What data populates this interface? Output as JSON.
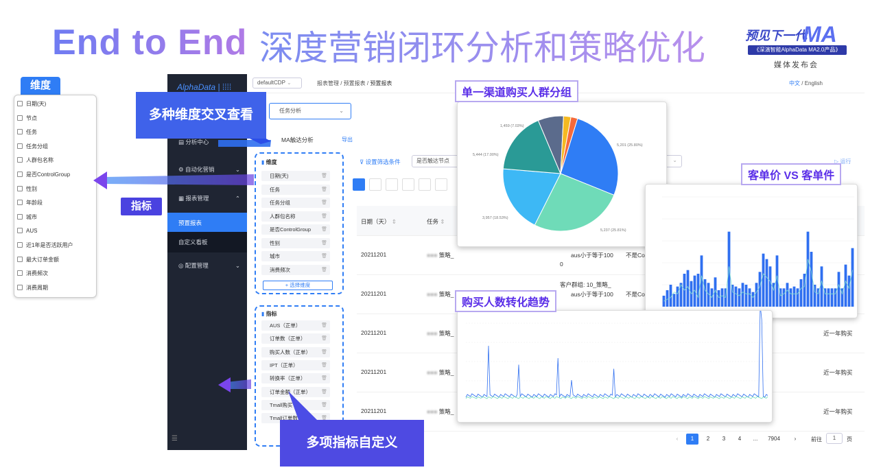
{
  "title": {
    "en": "End to End",
    "cn": "深度营销闭环分析和策略优化"
  },
  "logo": {
    "top": "预见下一代",
    "ma": "MA",
    "bar": "《深演智能AlphaData MA2.0产品》",
    "sub": "媒体发布会"
  },
  "dim_panel": {
    "tag": "维度",
    "items": [
      "日期(天)",
      "节点",
      "任务",
      "任务分组",
      "人群包名称",
      "是否ControlGroup",
      "性别",
      "年龄段",
      "城市",
      "AUS",
      "近1年是否活跃用户",
      "最大订单金额",
      "消费频次",
      "消费周期"
    ]
  },
  "callouts": {
    "multi_dim": "多种维度交叉查看",
    "metrics": "指标",
    "multi_metric": "多项指标自定义"
  },
  "sidebar": {
    "logo": "AlphaData | ⁞⁞⁞⁞",
    "items": [
      "分析中心",
      "自动化营销",
      "报表管理",
      "预置报表",
      "自定义看板",
      "配置管理"
    ],
    "footer_icon": "menu-icon"
  },
  "topbar": {
    "cdp": "defaultCDP",
    "breadcrumb": [
      "报表管理",
      "预置报表",
      "预置报表"
    ],
    "lang_cn": "中文",
    "lang_en": "English",
    "lang_sep": "/"
  },
  "main": {
    "task_select": "任务分析",
    "report_name": "MA触达分析",
    "export": "导出",
    "filter_label": "设置筛选条件",
    "filter_node": "是否触达节点",
    "run": "运行"
  },
  "dim_box": {
    "label": "维度",
    "items": [
      "日期(天)",
      "任务",
      "任务分组",
      "人群包名称",
      "是否ControlGroup",
      "性别",
      "城市",
      "消费频次"
    ],
    "add": "+ 选择维度"
  },
  "metric_box": {
    "label": "指标",
    "items": [
      "AUS（正单）",
      "订单数（正单）",
      "购买人数（正单）",
      "IPT（正单）",
      "转换率（正单）",
      "订单金额（正单）",
      "Tmall购买",
      "Tmall订单数"
    ]
  },
  "table": {
    "headers": [
      "日期（天）",
      "任务"
    ],
    "rows": [
      {
        "date": "20211201",
        "task": "策略_",
        "c3": "aus小于等于100",
        "c3b": "0",
        "c4": "不是Co"
      },
      {
        "date": "20211201",
        "task": "策略_",
        "c3a": "客户群组: 10_策略_",
        "c3": "aus小于等于100",
        "c4": "不是Co"
      },
      {
        "date": "20211201",
        "task": "策略_",
        "c5": "近一年购买"
      },
      {
        "date": "20211201",
        "task": "策略_",
        "c5": "近一年购买"
      },
      {
        "date": "20211201",
        "task": "策略_",
        "c5": "近一年购买"
      }
    ]
  },
  "pagination": {
    "pages": [
      "1",
      "2",
      "3",
      "4",
      "...",
      "7904"
    ],
    "goto": "前往",
    "goto_value": "1",
    "page_unit": "页"
  },
  "charts": {
    "pie_title": "单一渠道购买人群分组",
    "bar_title": "客单价 VS 客单件",
    "line_title": "购买人数转化趋势",
    "pie_labels": [
      "1,459 (7.03%)",
      "5,444 (17.00%)",
      "3,957 (18.53%)",
      "5,237 (25.81%)",
      "5,201 (25.80%)"
    ]
  },
  "chart_data": [
    {
      "type": "pie",
      "title": "单一渠道购买人群分组",
      "values": [
        25.8,
        25.81,
        18.53,
        17.0,
        7.03,
        2.03,
        1.84
      ],
      "colors": [
        "#2f7df5",
        "#6fdbb8",
        "#3db8f5",
        "#2a9a96",
        "#5b6b8c",
        "#f5b921",
        "#f56a3a"
      ]
    },
    {
      "type": "bar",
      "title": "客单价 VS 客单件",
      "ylim": [
        0,
        6000
      ],
      "values": [
        600,
        900,
        1200,
        700,
        1100,
        1300,
        1800,
        2000,
        1400,
        1700,
        1800,
        2800,
        1500,
        1300,
        1000,
        1600,
        900,
        1000,
        1000,
        4100,
        1200,
        1100,
        1000,
        1300,
        1200,
        1000,
        800,
        1300,
        1900,
        2900,
        2600,
        2200,
        1300,
        2800,
        1000,
        1000,
        1300,
        1000,
        1100,
        1000,
        1500,
        1800,
        4100,
        3000,
        1200,
        1000,
        2200,
        1000,
        1000,
        1000,
        1000,
        1900,
        1000,
        2300,
        1700,
        3200
      ],
      "line": [
        300,
        400,
        500,
        800,
        700,
        1200,
        900,
        1100,
        700,
        900,
        500,
        1700,
        900,
        700,
        500,
        900,
        500,
        600,
        500,
        2200,
        800,
        700,
        600,
        800,
        700,
        700,
        500,
        800,
        1100,
        1800,
        1600,
        1400,
        900,
        1700,
        600,
        700,
        900,
        700,
        700,
        700,
        1000,
        1100,
        2600,
        1900,
        800,
        700,
        1400,
        700,
        700,
        700,
        700,
        1200,
        700,
        1400,
        1000,
        2000
      ]
    },
    {
      "type": "line",
      "title": "购买人数转化趋势",
      "ylim": [
        0,
        1000
      ]
    }
  ],
  "colors": {
    "accent": "#2f7df5",
    "callout": "#3f4fe0",
    "sidebar": "#1f2533"
  }
}
